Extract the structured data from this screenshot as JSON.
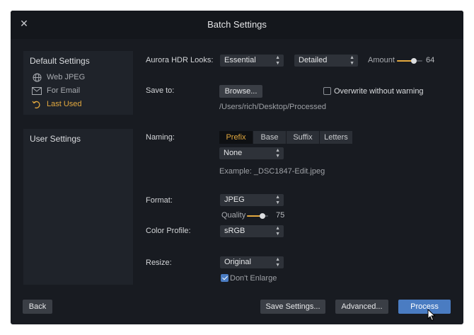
{
  "window": {
    "title": "Batch Settings"
  },
  "sidebar": {
    "default_title": "Default Settings",
    "presets": [
      {
        "label": "Web JPEG",
        "icon": "globe-icon"
      },
      {
        "label": "For Email",
        "icon": "envelope-icon"
      },
      {
        "label": "Last Used",
        "icon": "undo-icon",
        "active": true
      }
    ],
    "user_title": "User Settings"
  },
  "looks": {
    "label": "Aurora HDR Looks:",
    "category": "Essential",
    "look": "Detailed",
    "amount_label": "Amount",
    "amount": 64
  },
  "save": {
    "label": "Save to:",
    "browse": "Browse...",
    "overwrite_label": "Overwrite without warning",
    "overwrite": false,
    "path": "/Users/rich/Desktop/Processed"
  },
  "naming": {
    "label": "Naming:",
    "tabs": [
      "Prefix",
      "Base",
      "Suffix",
      "Letters"
    ],
    "active_tab": "Prefix",
    "value": "None",
    "example": "Example: _DSC1847-Edit.jpeg"
  },
  "format": {
    "label": "Format:",
    "value": "JPEG",
    "quality_label": "Quality",
    "quality": 75
  },
  "color_profile": {
    "label": "Color Profile:",
    "value": "sRGB"
  },
  "resize": {
    "label": "Resize:",
    "value": "Original",
    "dont_enlarge_label": "Don't Enlarge",
    "dont_enlarge": true
  },
  "footer": {
    "back": "Back",
    "save_settings": "Save Settings...",
    "advanced": "Advanced...",
    "process": "Process"
  },
  "colors": {
    "accent": "#e3a93f",
    "primary": "#4a7cc2",
    "background": "#181b21"
  }
}
